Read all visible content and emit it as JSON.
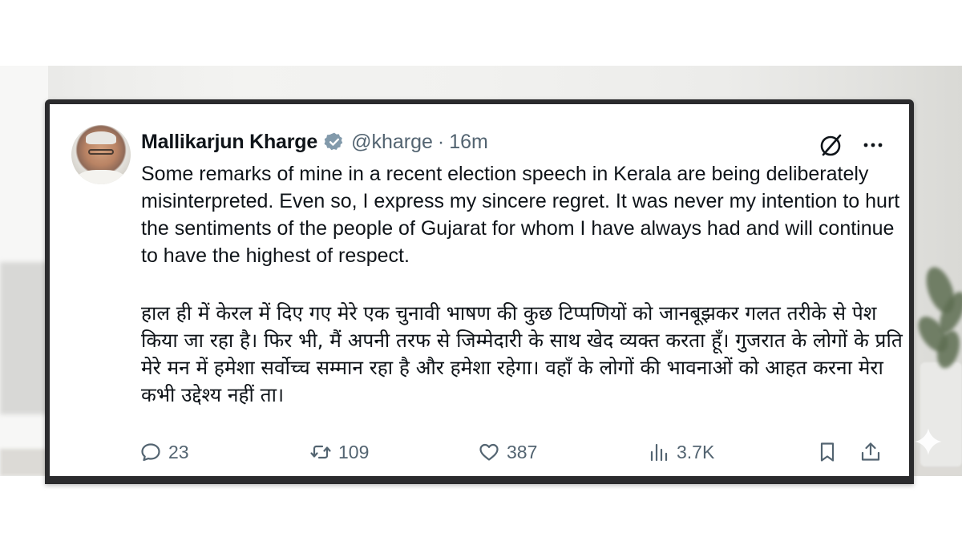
{
  "post": {
    "author": {
      "display_name": "Mallikarjun Kharge",
      "handle": "@kharge",
      "separator": "·",
      "time_ago": "16m",
      "verified_color": "#829aab"
    },
    "text_en": "Some remarks of mine in a recent election speech in Kerala are being deliberately misinterpreted. Even so, I express my sincere regret. It was never my intention to hurt the sentiments of the people of Gujarat for whom I have always had and will continue to have the highest of respect.",
    "text_hi": "हाल ही में केरल में दिए गए मेरे एक चुनावी भाषण की कुछ टिप्पणियों को जानबूझकर गलत तरीके से पेश किया जा रहा है। फिर भी, मैं अपनी तरफ से जिम्मेदारी के साथ खेद व्यक्त करता हूँ। गुजरात के लोगों के प्रति मेरे मन में हमेशा सर्वोच्च सम्मान रहा है और हमेशा रहेगा। वहाँ के लोगों की भावनाओं को आहत करना मेरा कभी उद्देश्य नहीं ता।",
    "header_icons": [
      "grok-icon",
      "more-icon"
    ],
    "actions": {
      "replies": "23",
      "reposts": "109",
      "likes": "387",
      "views": "3.7K",
      "icons": [
        "reply-icon",
        "repost-icon",
        "like-icon",
        "views-icon",
        "bookmark-icon",
        "share-icon"
      ]
    }
  },
  "colors": {
    "text_primary": "#0f1419",
    "text_secondary": "#536471",
    "bezel": "#2b2b2d"
  }
}
